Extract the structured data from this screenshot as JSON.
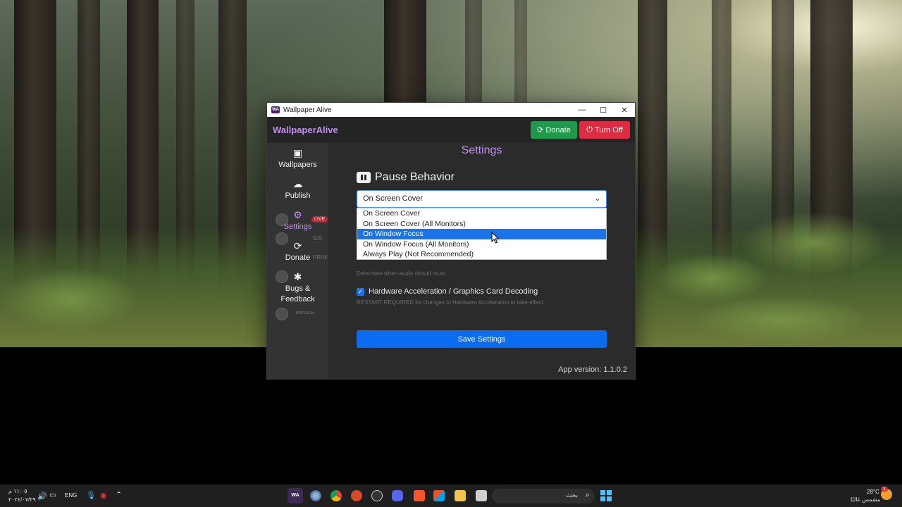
{
  "window": {
    "title": "Wallpaper Alive",
    "brand": "WallpaperAlive",
    "donate_label": "Donate",
    "turnoff_label": "Turn Off",
    "minimize_icon": "—",
    "maximize_icon": "☐",
    "close_icon": "✕"
  },
  "sidebar": {
    "items": [
      {
        "label": "Wallpapers",
        "icon": "image-icon",
        "glyph": "🖼"
      },
      {
        "label": "Publish",
        "icon": "cloud-upload-icon",
        "glyph": "☁"
      },
      {
        "label": "Settings",
        "icon": "gear-icon",
        "glyph": "⚙"
      },
      {
        "label": "Donate",
        "icon": "donate-icon",
        "glyph": "⟳"
      },
      {
        "label": "Bugs &",
        "label2": "Feedback",
        "icon": "bug-icon",
        "glyph": "✱"
      }
    ]
  },
  "settings": {
    "title": "Settings",
    "pause_section_title": "Pause Behavior",
    "pause_selected": "On Screen Cover",
    "pause_options": [
      "On Screen Cover",
      "On Screen Cover (All Monitors)",
      "On Window Focus",
      "On Window Focus (All Monitors)",
      "Always Play (Not Recommended)"
    ],
    "highlighted_option_index": 2,
    "audio_hint": "Determine when audio should mute.",
    "hw_accel_label": "Hardware Acceleration / Graphics Card Decoding",
    "hw_accel_checked": true,
    "hw_accel_hint": "RESTART REQUIRED for changes to Hardware Acceleration to take effect.",
    "save_label": "Save Settings",
    "version": "App version: 1.1.0.2"
  },
  "overlay": {
    "live_badge": "LIVE",
    "count1": "505",
    "prime": "PRIM",
    "user": "MANSOR"
  },
  "taskbar": {
    "search_placeholder": "بحث",
    "weather_temp": "28°C",
    "weather_desc": "مشمس غالبًا",
    "weather_badge": "1",
    "language": "ENG",
    "time": "١١:٠٥ م",
    "date": "٢٠٢٤/٠٧/٢٩"
  },
  "colors": {
    "accent_purple": "#c28ff0",
    "donate_green": "#1f9a4c",
    "turnoff_red": "#dc2b43",
    "save_blue": "#0b6cf0",
    "selection_blue": "#1a73e8"
  }
}
